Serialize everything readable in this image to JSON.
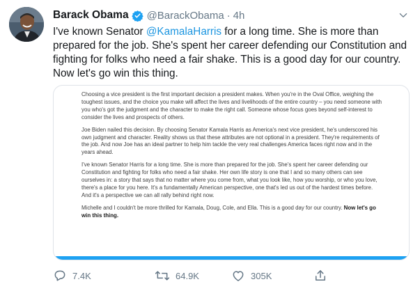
{
  "author": {
    "name": "Barack Obama",
    "handle": "@BarackObama",
    "separator": "·",
    "time": "4h"
  },
  "tweet": {
    "text_before_mention": "I've known Senator ",
    "mention": "@KamalaHarris",
    "text_after_mention": " for a long time. She is more than prepared for the job. She's spent her career defending our Constitution and fighting for folks who need a fair shake. This is a good day for our country. Now let's go win this thing."
  },
  "statement": {
    "paragraphs": [
      "Choosing a vice president is the first important decision a president makes. When you're in the Oval Office, weighing the toughest issues, and the choice you make will affect the lives and livelihoods of the entire country – you need someone with you who's got the judgment and the character to make the right call. Someone whose focus goes beyond self-interest to consider the lives and prospects of others.",
      "Joe Biden nailed this decision. By choosing Senator Kamala Harris as America's next vice president, he's underscored his own judgment and character. Reality shows us that these attributes are not optional in a president. They're requirements of the job. And now Joe has an ideal partner to help him tackle the very real challenges America faces right now and in the years ahead.",
      "I've known Senator Harris for a long time. She is more than prepared for the job. She's spent her career defending our Constitution and fighting for folks who need a fair shake. Her own life story is one that I and so many others can see ourselves in: a story that says that no matter where you come from, what you look like, how you worship, or who you love, there's a place for you here. It's a fundamentally American perspective, one that's led us out of the hardest times before. And it's a perspective we can all rally behind right now."
    ],
    "closing_text": "Michelle and I couldn't be more thrilled for Kamala, Doug, Cole, and Ella. This is a good day for our country. ",
    "closing_bold": "Now let's go win this thing."
  },
  "actions": {
    "replies": "7.4K",
    "retweets": "64.9K",
    "likes": "305K"
  },
  "icons": {
    "verified": "verified-badge-icon",
    "caret": "chevron-down-icon",
    "reply": "reply-icon",
    "retweet": "retweet-icon",
    "like": "heart-icon",
    "share": "share-icon"
  },
  "colors": {
    "accent": "#1da1f2",
    "mention": "#1b95e0",
    "muted": "#657786"
  }
}
